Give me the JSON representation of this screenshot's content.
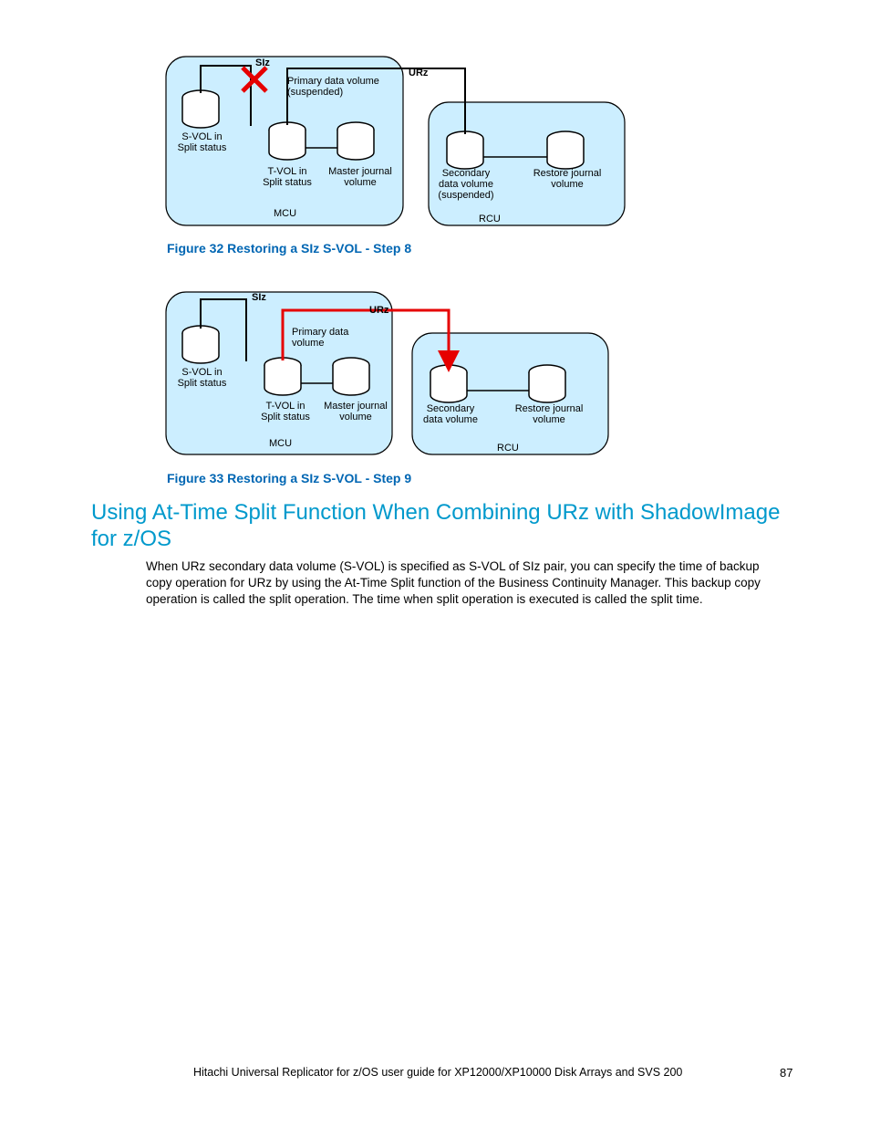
{
  "fig32": {
    "caption": "Figure 32 Restoring a SIz S-VOL - Step 8",
    "siz": "SIz",
    "urz": "URz",
    "svol_l1": "S-VOL in",
    "svol_l2": "Split status",
    "tvol_l1": "T-VOL in",
    "tvol_l2": "Split status",
    "pdv_l1": "Primary data volume",
    "pdv_l2": "(suspended)",
    "mjv_l1": "Master journal",
    "mjv_l2": "volume",
    "sdv_l1": "Secondary",
    "sdv_l2": "data volume",
    "sdv_l3": "(suspended)",
    "rjv_l1": "Restore journal",
    "rjv_l2": "volume",
    "mcu": "MCU",
    "rcu": "RCU"
  },
  "fig33": {
    "caption": "Figure 33 Restoring a SIz S-VOL - Step 9",
    "siz": "SIz",
    "urz": "URz",
    "svol_l1": "S-VOL in",
    "svol_l2": "Split status",
    "tvol_l1": "T-VOL in",
    "tvol_l2": "Split status",
    "pdv_l1": "Primary data",
    "pdv_l2": "volume",
    "mjv_l1": "Master journal",
    "mjv_l2": "volume",
    "sdv_l1": "Secondary",
    "sdv_l2": "data volume",
    "rjv_l1": "Restore journal",
    "rjv_l2": "volume",
    "mcu": "MCU",
    "rcu": "RCU"
  },
  "heading": "Using At-Time Split Function When Combining URz with ShadowImage for z/OS",
  "body": "When URz secondary data volume (S-VOL) is specified as S-VOL of SIz pair, you can specify the time of backup copy operation for URz by using the At-Time Split function of the Business Continuity Manager. This backup copy operation is called the split operation. The time when split operation is executed is called the split time.",
  "footer": "Hitachi Universal Replicator for z/OS user guide for XP12000/XP10000 Disk Arrays and SVS 200",
  "page": "87"
}
